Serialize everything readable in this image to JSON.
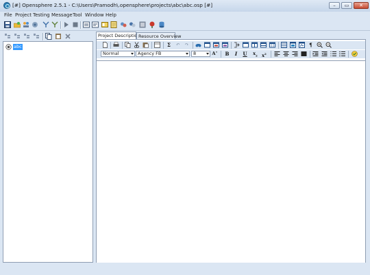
{
  "window": {
    "title": "[#] Opensphere 2.5.1 - C:\\Users\\Pramodh\\.opensphere\\projects\\abc\\abc.osp [#]",
    "controls": [
      "minimize-icon",
      "restore-icon",
      "close-icon"
    ]
  },
  "menu": [
    "File",
    "Project",
    "Testing",
    "Message",
    "Tool",
    "Window",
    "Help"
  ],
  "main_toolbar": [
    "save-icon",
    "open-folder-icon",
    "users-icon",
    "network-icon",
    "properties-icon",
    "filter-icon",
    "play-icon",
    "stop-icon",
    "log-icon",
    "report-icon",
    "card-icon",
    "notes-icon",
    "refresh-icon",
    "tools-icon",
    "chart-icon",
    "pin-icon",
    "database-icon"
  ],
  "left_toolbar": [
    "new-suite-icon",
    "new-case-icon",
    "new-step-icon",
    "add-icon",
    "copy-icon",
    "paste-icon",
    "delete-icon"
  ],
  "tree": {
    "root": {
      "label": "abc",
      "icon": "project-icon",
      "selected": true
    }
  },
  "tabs": [
    {
      "label": "Project Description",
      "active": true
    },
    {
      "label": "Resource Overview",
      "active": false
    }
  ],
  "editor": {
    "style_select": "Normal",
    "font_select": "Agency FB",
    "size_select": "8",
    "format_buttons": {
      "bold": "B",
      "italic": "I",
      "underline": "U",
      "subscript": "x",
      "superscript": "x"
    },
    "toolbar1_icons": [
      "new-doc-icon",
      "print-icon",
      "copy-icon",
      "cut-icon",
      "paste-icon",
      "table-icon",
      "sum-icon",
      "undo-icon",
      "redo-icon",
      "find-icon",
      "frame-icon",
      "image-icon",
      "link-icon",
      "text-box-icon",
      "table-insert-icon",
      "merge-icon",
      "split-icon",
      "row-icon",
      "column-icon",
      "grid-icon",
      "anchor-icon",
      "pilcrow-icon",
      "zoom-in-icon",
      "zoom-out-icon"
    ],
    "toolbar2_icons": [
      "font-grow-icon",
      "align-left-icon",
      "align-center-icon",
      "align-right-icon",
      "justify-icon",
      "indent-icon",
      "outdent-icon",
      "numbered-list-icon",
      "bullet-list-icon",
      "spellcheck-icon"
    ]
  }
}
